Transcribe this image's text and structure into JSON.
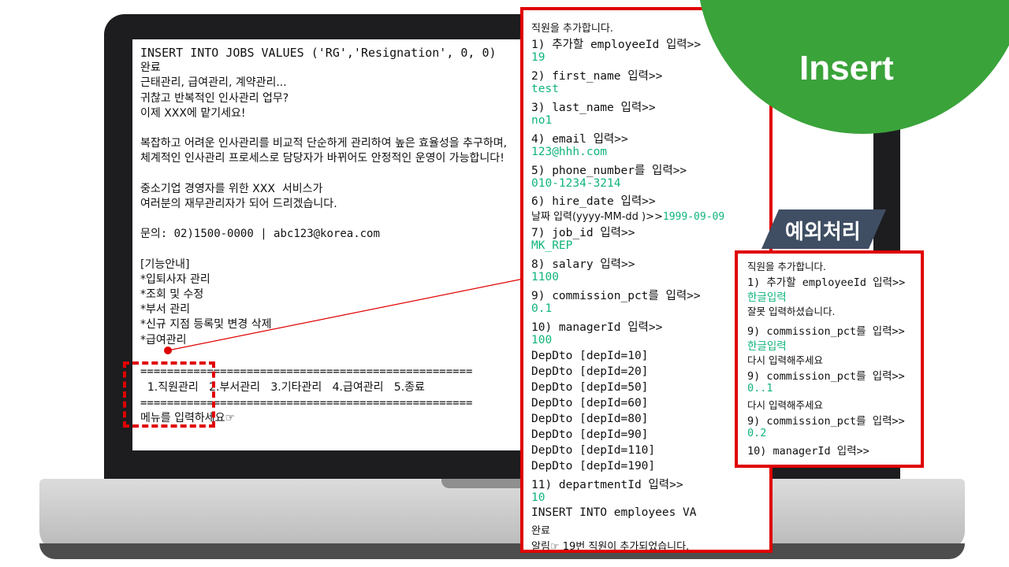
{
  "main_console": {
    "lines": [
      "INSERT INTO JOBS VALUES ('RG','Resignation', 0, 0)",
      "완료",
      "근태관리, 급여관리, 계약관리...",
      "귀찮고 반복적인 인사관리 업무?",
      "이제 XXX에 맡기세요!",
      "",
      "복잡하고 어려운 인사관리를 비교적 단순하게 관리하여 높은 효율성을 추구하며,",
      "체계적인 인사관리 프로세스로 담당자가 바뀌어도 안정적인 운영이 가능합니다!",
      "",
      "중소기업 경영자를 위한 XXX  서비스가",
      "여러분의 재무관리자가 되어 드리겠습니다.",
      "",
      "문의: 02)1500-0000 | abc123@korea.com",
      "",
      "[기능안내]",
      "*입퇴사자 관리",
      "*조회 및 수정",
      "*부서 관리",
      "*신규 지점 등록및 변경 삭제",
      "*급여관리"
    ],
    "separator": "==================================================",
    "menu": "  1.직원관리   2.부서관리   3.기타관리   4.급여관리   5.종료",
    "prompt": "메뉴를 입력하세요☞"
  },
  "insert_panel": {
    "lines": [
      {
        "text": "직원을 추가합니다.",
        "kind": "kr"
      },
      {
        "text": "1) 추가할 employeeId 입력>>",
        "kind": "mono"
      },
      {
        "text": "19",
        "kind": "in"
      },
      {
        "text": "2) first_name 입력>>",
        "kind": "mono"
      },
      {
        "text": "test",
        "kind": "in"
      },
      {
        "text": "3) last_name 입력>>",
        "kind": "mono"
      },
      {
        "text": "no1",
        "kind": "in"
      },
      {
        "text": "4) email 입력>>",
        "kind": "mono"
      },
      {
        "text": "123@hhh.com",
        "kind": "in"
      },
      {
        "text": "5) phone_number를 입력>>",
        "kind": "mono"
      },
      {
        "text": "010-1234-3214",
        "kind": "in"
      },
      {
        "text": "6) hire_date 입력>>",
        "kind": "mono"
      },
      {
        "text": "날짜 입력(yyyy-MM-dd )>>",
        "suffix": "1999-09-09",
        "kind": "kr"
      },
      {
        "text": "7) job_id 입력>>",
        "kind": "mono"
      },
      {
        "text": "MK_REP",
        "kind": "in"
      },
      {
        "text": "8) salary 입력>>",
        "kind": "mono"
      },
      {
        "text": "1100",
        "kind": "in"
      },
      {
        "text": "9) commission_pct를 입력>>",
        "kind": "mono"
      },
      {
        "text": "0.1",
        "kind": "in"
      },
      {
        "text": "10) managerId 입력>>",
        "kind": "mono"
      },
      {
        "text": "100",
        "kind": "in"
      },
      {
        "text": "DepDto [depId=10]",
        "kind": "mono"
      },
      {
        "text": "DepDto [depId=20]",
        "kind": "mono"
      },
      {
        "text": "DepDto [depId=50]",
        "kind": "mono"
      },
      {
        "text": "DepDto [depId=60]",
        "kind": "mono"
      },
      {
        "text": "DepDto [depId=80]",
        "kind": "mono"
      },
      {
        "text": "DepDto [depId=90]",
        "kind": "mono"
      },
      {
        "text": "DepDto [depId=110]",
        "kind": "mono"
      },
      {
        "text": "DepDto [depId=190]",
        "kind": "mono"
      },
      {
        "text": "11) departmentId 입력>>",
        "kind": "mono"
      },
      {
        "text": "10",
        "kind": "in"
      },
      {
        "text": "INSERT INTO employees VA",
        "kind": "mono"
      },
      {
        "text": "완료",
        "kind": "kr"
      },
      {
        "text": "알림☞ 19번 직원이 추가되었습니다.",
        "kind": "kr"
      }
    ]
  },
  "badge": {
    "label": "Insert",
    "color": "#3aa33a"
  },
  "exception": {
    "tag": "예외처리",
    "lines": [
      {
        "text": "직원을 추가합니다.",
        "kind": "kr"
      },
      {
        "text": "1) 추가할 employeeId 입력>>",
        "kind": "mono"
      },
      {
        "text": "한글입력",
        "kind": "in"
      },
      {
        "text": "잘못 입력하셨습니다.",
        "kind": "kr"
      },
      {
        "text": "9) commission_pct를 입력>>",
        "kind": "mono"
      },
      {
        "text": "한글입력",
        "kind": "in"
      },
      {
        "text": "다시 입력해주세요",
        "kind": "kr"
      },
      {
        "text": "9) commission_pct를 입력>>",
        "kind": "mono"
      },
      {
        "text": "0..1",
        "kind": "in"
      },
      {
        "text": "다시 입력해주세요",
        "kind": "kr"
      },
      {
        "text": "9) commission_pct를 입력>>",
        "kind": "mono"
      },
      {
        "text": "0.2",
        "kind": "in"
      },
      {
        "text": "10) managerId 입력>>",
        "kind": "mono"
      }
    ]
  },
  "colors": {
    "highlight": "#e00000",
    "input_text": "#10b57a",
    "tag_bg": "#3f4e63"
  }
}
